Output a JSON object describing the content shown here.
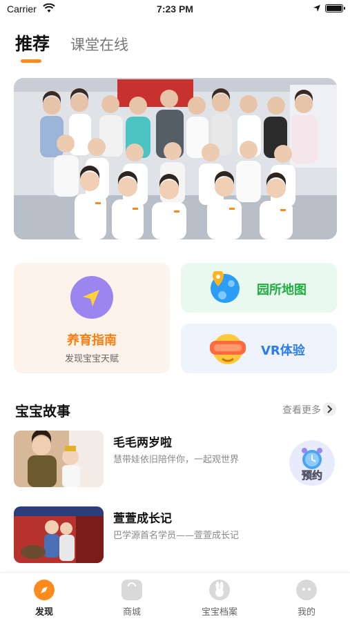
{
  "status_bar": {
    "carrier": "Carrier",
    "time": "7:23 PM",
    "battery_level": 1.0
  },
  "top_tabs": [
    {
      "label": "推荐",
      "active": true
    },
    {
      "label": "课堂在线",
      "active": false
    }
  ],
  "accent_color": "#ff8a1e",
  "banner": {
    "image": "group-photo"
  },
  "features": {
    "guide": {
      "title": "养育指南",
      "subtitle": "发现宝宝天赋",
      "icon": "navigation-arrow-icon"
    },
    "map": {
      "title": "园所地图",
      "icon": "map-pin-globe-icon"
    },
    "vr": {
      "title": "VR体验",
      "icon": "vr-headset-icon"
    }
  },
  "stories_section": {
    "title": "宝宝故事",
    "more_label": "查看更多",
    "items": [
      {
        "title": "毛毛两岁啦",
        "desc": "慧带娃依旧陪伴你，一起观世界"
      },
      {
        "title": "萱萱成长记",
        "desc": "巴学源首名学员——萱萱成长记"
      }
    ],
    "reserve_label": "预约"
  },
  "bottom_nav": [
    {
      "label": "发现",
      "icon": "compass-icon",
      "active": true
    },
    {
      "label": "商城",
      "icon": "shopping-bag-icon",
      "active": false
    },
    {
      "label": "宝宝档案",
      "icon": "rabbit-icon",
      "active": false
    },
    {
      "label": "我的",
      "icon": "profile-icon",
      "active": false
    }
  ]
}
